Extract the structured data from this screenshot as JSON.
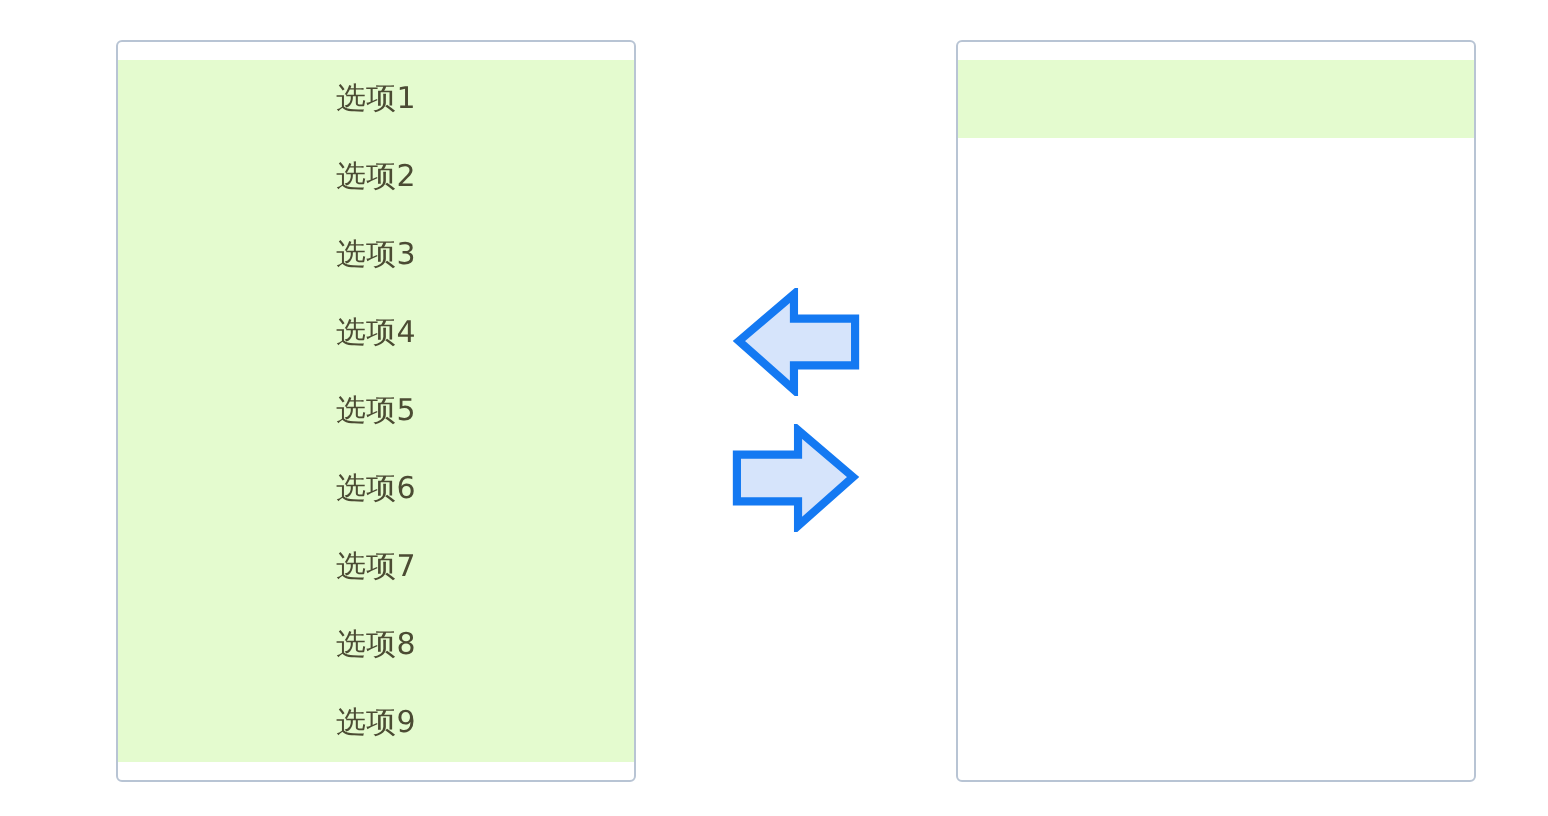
{
  "left_list": {
    "items": [
      {
        "label": "选项1"
      },
      {
        "label": "选项2"
      },
      {
        "label": "选项3"
      },
      {
        "label": "选项4"
      },
      {
        "label": "选项5"
      },
      {
        "label": "选项6"
      },
      {
        "label": "选项7"
      },
      {
        "label": "选项8"
      },
      {
        "label": "选项9"
      }
    ]
  },
  "transfer_buttons": [
    {
      "kind": "left"
    },
    {
      "kind": "right"
    }
  ]
}
